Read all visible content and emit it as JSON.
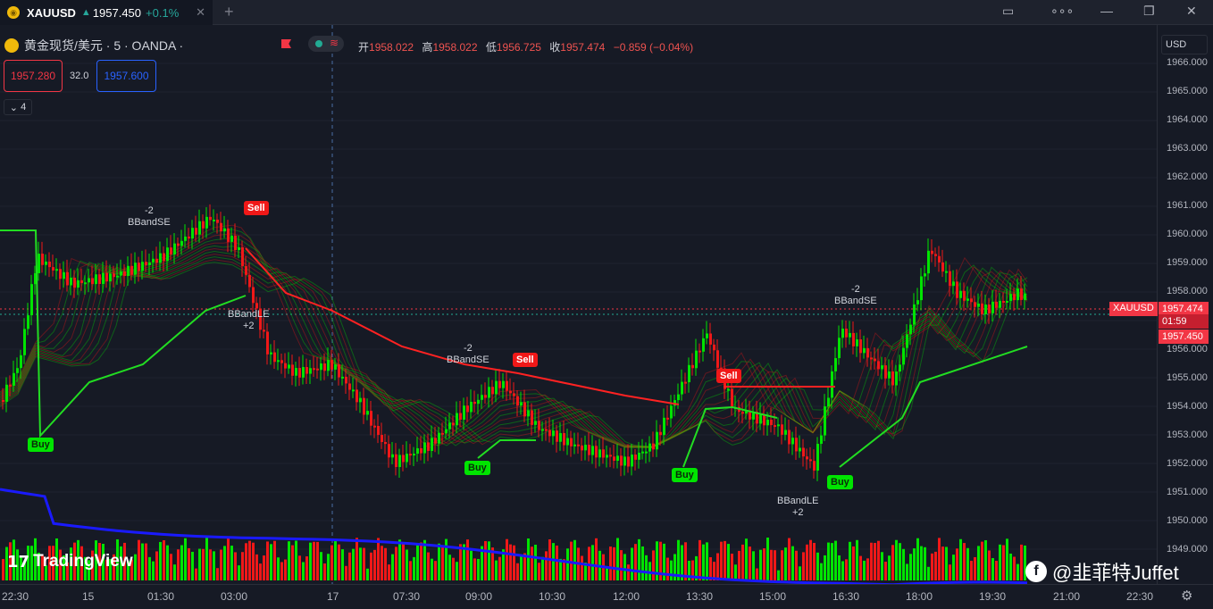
{
  "tab": {
    "symbol": "XAUUSD",
    "price": "1957.450",
    "change": "+0.1%"
  },
  "legend": {
    "title": "黄金现货/美元 · 5 · OANDA ·"
  },
  "ohlc": {
    "open_label": "开",
    "open": "1958.022",
    "high_label": "高",
    "high": "1958.022",
    "low_label": "低",
    "low": "1956.725",
    "close_label": "收",
    "close": "1957.474",
    "change": "−0.859 (−0.04%)"
  },
  "trade": {
    "sell_price": "1957.280",
    "spread": "32.0",
    "buy_price": "1957.600"
  },
  "indicators_count": "4",
  "currency": "USD",
  "price_axis": [
    "1966.000",
    "1965.000",
    "1964.000",
    "1963.000",
    "1962.000",
    "1961.000",
    "1960.000",
    "1959.000",
    "1958.000",
    "1956.000",
    "1955.000",
    "1954.000",
    "1953.000",
    "1952.000",
    "1951.000",
    "1950.000",
    "1949.000"
  ],
  "price_labels": {
    "symbol": "XAUUSD",
    "last": "1957.474",
    "countdown": "01:59",
    "bid": "1957.450"
  },
  "time_axis": [
    "22:30",
    "15",
    "01:30",
    "03:00",
    "17",
    "07:30",
    "09:00",
    "10:30",
    "12:00",
    "13:30",
    "15:00",
    "16:30",
    "18:00",
    "19:30",
    "21:00",
    "22:30"
  ],
  "signals": [
    {
      "label": "Buy"
    },
    {
      "label": "Sell"
    },
    {
      "label": "Buy"
    },
    {
      "label": "Sell"
    },
    {
      "label": "Sell"
    },
    {
      "label": "Buy"
    },
    {
      "label": "Buy"
    }
  ],
  "annotations": [
    {
      "text1": "-2",
      "text2": "BBandSE"
    },
    {
      "text1": "BBandLE",
      "text2": "+2"
    },
    {
      "text1": "-2",
      "text2": "BBandSE"
    },
    {
      "text1": "BBandLE",
      "text2": "+2"
    },
    {
      "text1": "-2",
      "text2": "BBandSE"
    }
  ],
  "branding": {
    "logo": "TradingView",
    "watermark": "@韭菲特Juffet"
  },
  "colors": {
    "bull": "#00e400",
    "bear": "#f01818",
    "volume_ma": "#1a1aff",
    "accent_red": "#f23645",
    "accent_blue": "#2962ff"
  }
}
